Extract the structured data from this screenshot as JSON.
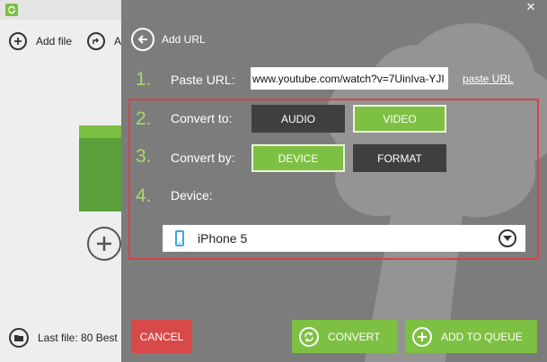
{
  "background_app": {
    "toolbar": {
      "add_file_label": "Add file",
      "second_item_label": "A"
    },
    "status": {
      "last_file_label": "Last file: 80 Best"
    }
  },
  "dialog": {
    "title": "Add URL",
    "close_glyph": "✕",
    "steps": [
      {
        "number": "1.",
        "label": "Paste URL:"
      },
      {
        "number": "2.",
        "label": "Convert to:"
      },
      {
        "number": "3.",
        "label": "Convert by:"
      },
      {
        "number": "4.",
        "label": "Device:"
      }
    ],
    "url_value": "www.youtube.com/watch?v=7UinIva-YJI",
    "paste_url_link": "paste URL",
    "convert_to": {
      "options": [
        "AUDIO",
        "VIDEO"
      ],
      "selected": "VIDEO"
    },
    "convert_by": {
      "options": [
        "DEVICE",
        "FORMAT"
      ],
      "selected": "DEVICE"
    },
    "device": {
      "selected": "iPhone 5",
      "icon": "phone-icon"
    },
    "buttons": {
      "cancel": "CANCEL",
      "convert": "CONVERT",
      "add_to_queue": "ADD TO QUEUE"
    }
  },
  "colors": {
    "accent_green": "#7ec043",
    "step_number_green": "#a8d86b",
    "cancel_red": "#d84a4a",
    "highlight_border": "#d8434a",
    "panel_bg": "#7c7c7c",
    "dark_button": "#3f3f3f"
  }
}
